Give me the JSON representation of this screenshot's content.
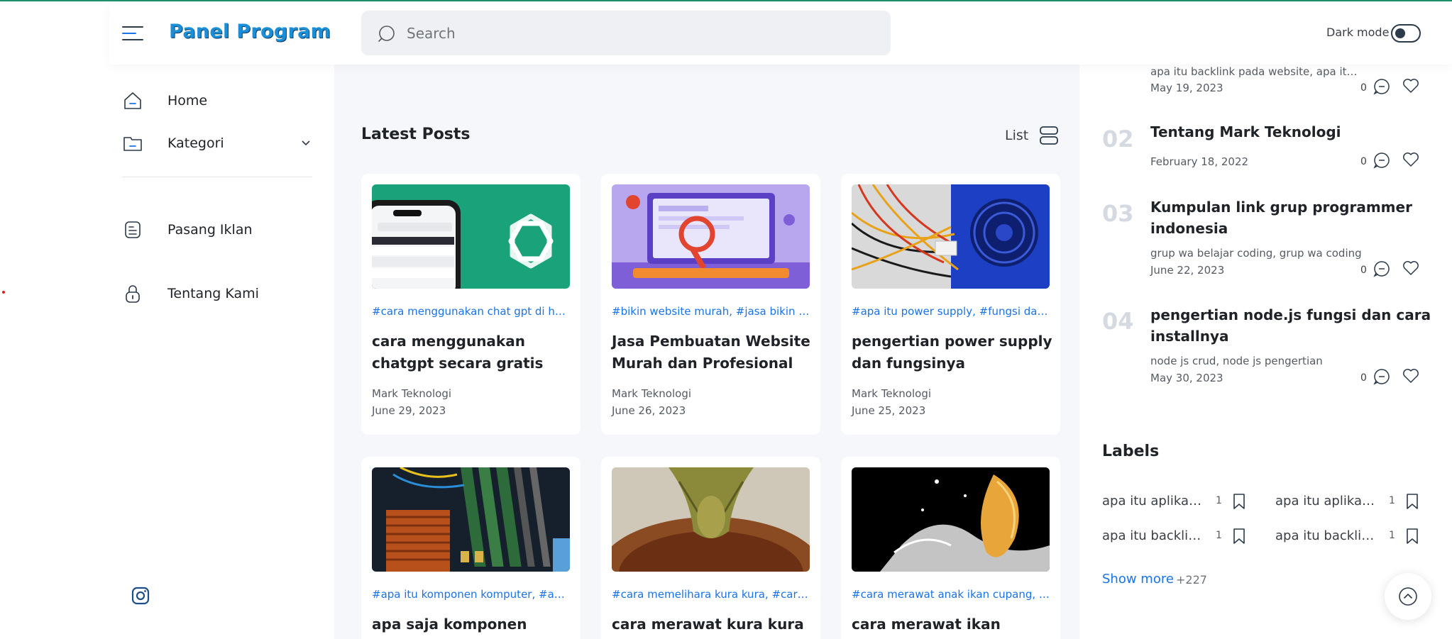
{
  "header": {
    "brand": "Panel Program",
    "search_placeholder": "Search",
    "dark_mode_label": "Dark mode"
  },
  "sidebar": {
    "items": [
      {
        "label": "Home"
      },
      {
        "label": "Kategori"
      },
      {
        "label": "Pasang Iklan"
      },
      {
        "label": "Tentang Kami"
      }
    ]
  },
  "main": {
    "section_title": "Latest Posts",
    "view_label": "List",
    "posts": [
      {
        "tags": "#cara menggunakan chat gpt di hp, #cara menggunakan chat gpt",
        "title": "cara menggunakan chatgpt secara gratis",
        "author": "Mark Teknologi",
        "date": "June 29, 2023"
      },
      {
        "tags": "#bikin website murah, #jasa bikin website",
        "title": "Jasa Pembuatan Website Murah dan Profesional",
        "author": "Mark Teknologi",
        "date": "June 26, 2023"
      },
      {
        "tags": "#apa itu power supply, #fungsi dari power supply",
        "title": "pengertian power supply dan fungsinya",
        "author": "Mark Teknologi",
        "date": "June 25, 2023"
      },
      {
        "tags": "#apa itu komponen komputer, #apa saja komponen komputer",
        "title": "apa saja komponen",
        "author": "",
        "date": ""
      },
      {
        "tags": "#cara memelihara kura kura, #cara merawat kura kura",
        "title": "cara merawat kura kura",
        "author": "",
        "date": ""
      },
      {
        "tags": "#cara merawat anak ikan cupang, #cara merawat ikan cupang",
        "title": "cara merawat ikan cupang",
        "author": "",
        "date": ""
      }
    ]
  },
  "popular": {
    "items": [
      {
        "num": "",
        "title": "",
        "snippet": "apa itu backlink pada website, apa itu backlink",
        "date": "May 19, 2023",
        "comments": "0"
      },
      {
        "num": "02",
        "title": "Tentang Mark Teknologi",
        "snippet": "",
        "date": "February 18, 2022",
        "comments": "0"
      },
      {
        "num": "03",
        "title": "Kumpulan link grup programmer indonesia",
        "snippet": "grup wa belajar coding, grup wa coding",
        "date": "June 22, 2023",
        "comments": "0"
      },
      {
        "num": "04",
        "title": "pengertian node.js fungsi dan cara installnya",
        "snippet": "node js crud, node js pengertian",
        "date": "May 30, 2023",
        "comments": "0"
      }
    ]
  },
  "labels": {
    "title": "Labels",
    "items": [
      {
        "name": "apa itu aplikasi canva",
        "count": "1"
      },
      {
        "name": "apa itu aplikasi figma",
        "count": "1"
      },
      {
        "name": "apa itu backlink pada website",
        "count": "1"
      },
      {
        "name": "apa itu backlink seo",
        "count": "1"
      }
    ],
    "show_more": "Show more",
    "more_count": "+227"
  }
}
